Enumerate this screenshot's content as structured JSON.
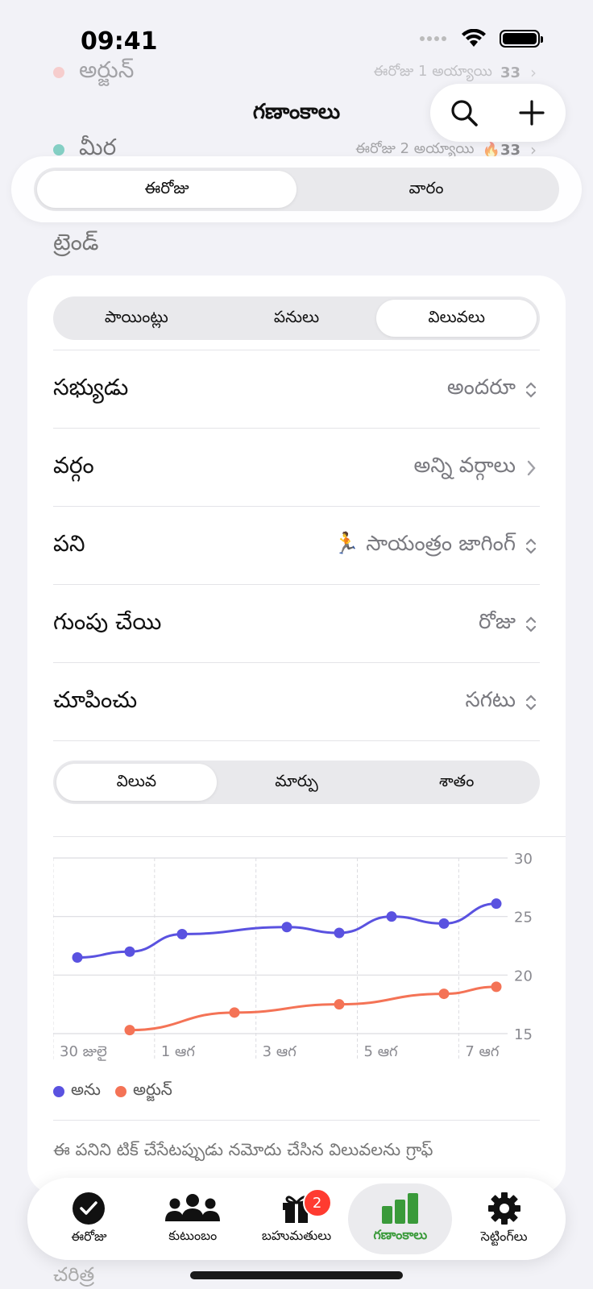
{
  "status": {
    "time": "09:41"
  },
  "background_list": [
    {
      "name": "అర్జున్",
      "meta": "ఈరోజు 1 అయ్యాయి",
      "streak": "33",
      "color": "#ff8a80"
    },
    {
      "name": "మీర",
      "meta": "ఈరోజు 2 అయ్యాయి",
      "streak": "33",
      "color": "#2bb39b"
    }
  ],
  "header": {
    "title": "గణాంకాలు",
    "search_icon": "magnifier-icon",
    "add_icon": "plus-icon"
  },
  "period_tabs": [
    "ఈరోజు",
    "వారం"
  ],
  "section_title": "ట్రెండ్",
  "metric_tabs": [
    "పాయింట్లు",
    "పనులు",
    "విలువలు"
  ],
  "rows": [
    {
      "label": "సభ్యుడు",
      "value": "అందరూ"
    },
    {
      "label": "వర్గం",
      "value": "అన్ని వర్గాలు"
    },
    {
      "label": "పని",
      "value": "🏃 సాయంత్రం జాగింగ్"
    },
    {
      "label": "గుంపు చేయి",
      "value": "రోజు"
    },
    {
      "label": "చూపించు",
      "value": "సగటు"
    }
  ],
  "mode_tabs": [
    "విలువ",
    "మార్పు",
    "శాతం"
  ],
  "chart_data": {
    "type": "line",
    "x": [
      "30 జులై",
      "31 జులై",
      "1 ఆగ",
      "2 ఆగ",
      "3 ఆగ",
      "4 ఆగ",
      "5 ఆగ",
      "6 ఆగ",
      "7 ఆగ"
    ],
    "x_tick_labels": [
      "30 జులై",
      "1 ఆగ",
      "3 ఆగ",
      "5 ఆగ",
      "7 ఆగ"
    ],
    "ylim": [
      15,
      30
    ],
    "y_ticks": [
      "30",
      "25",
      "20",
      "15"
    ],
    "series": [
      {
        "name": "అను",
        "color": "#5a52e0",
        "values": [
          21.5,
          22.0,
          23.5,
          null,
          24.1,
          23.6,
          25.0,
          24.4,
          26.1
        ]
      },
      {
        "name": "అర్జున్",
        "color": "#f47356",
        "values": [
          null,
          15.3,
          null,
          16.8,
          null,
          17.5,
          null,
          18.4,
          19.0
        ]
      }
    ],
    "legend_position": "bottom-left",
    "grid": true
  },
  "note": "ఈ పనిని టిక్ చేసేటప్పుడు నమోదు చేసిన విలువలను గ్రాఫ్",
  "tabbar": [
    {
      "label": "ఈరోజు",
      "icon": "checkmark-circle-icon"
    },
    {
      "label": "కుటుంబం",
      "icon": "people-icon"
    },
    {
      "label": "బహుమతులు",
      "icon": "gift-icon",
      "badge": "2"
    },
    {
      "label": "గణాంకాలు",
      "icon": "bar-chart-icon",
      "active": true
    },
    {
      "label": "సెట్టింగ్‌లు",
      "icon": "gear-icon"
    }
  ],
  "history_label": "చరిత్ర"
}
